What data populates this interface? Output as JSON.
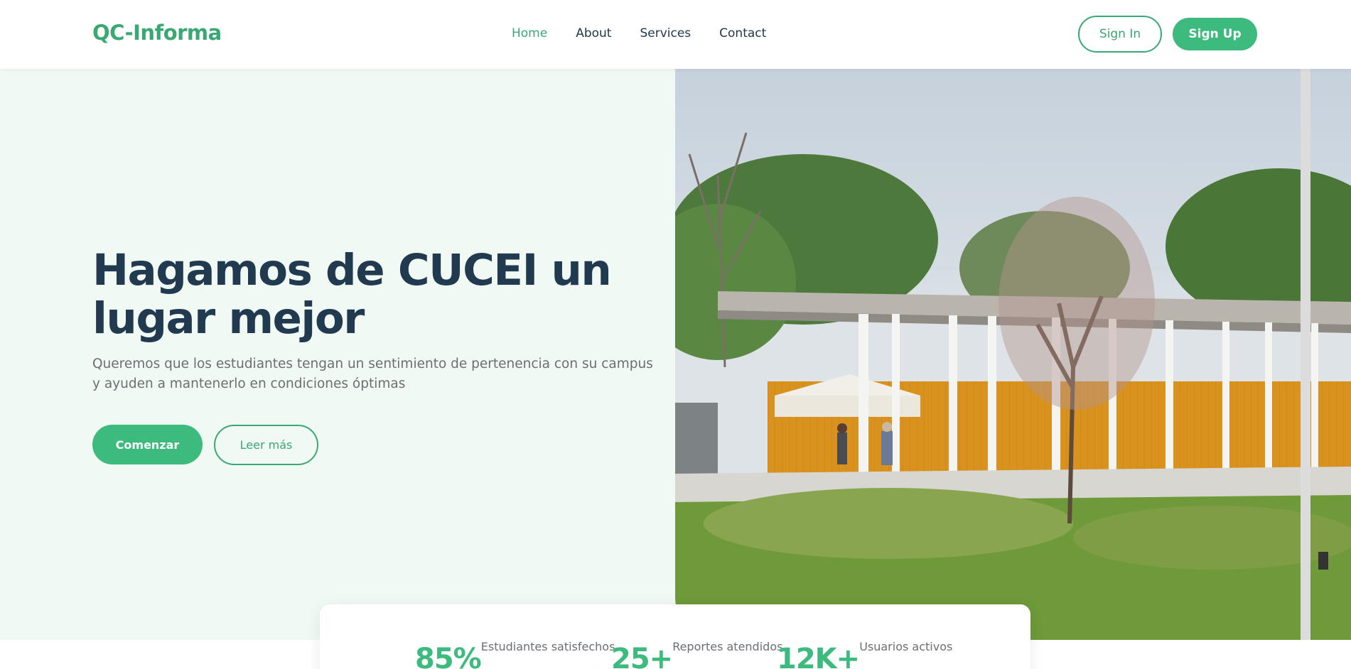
{
  "header": {
    "logo": "QC-Informa",
    "nav": [
      {
        "label": "Home",
        "active": true
      },
      {
        "label": "About",
        "active": false
      },
      {
        "label": "Services",
        "active": false
      },
      {
        "label": "Contact",
        "active": false
      }
    ],
    "sign_in": "Sign In",
    "sign_up": "Sign Up"
  },
  "hero": {
    "title": "Hagamos de CUCEI un lugar mejor",
    "description": "Queremos que los estudiantes tengan un sentimiento de pertenencia con su campus y ayuden a mantenerlo en condiciones óptimas",
    "primary_button": "Comenzar",
    "secondary_button": "Leer más",
    "image_icon": "campus-photo"
  },
  "stats": [
    {
      "value": "85%",
      "label": "Estudiantes satisfechos"
    },
    {
      "value": "25+",
      "label": "Reportes atendidos"
    },
    {
      "value": "12K+",
      "label": "Usuarios activos"
    }
  ],
  "colors": {
    "accent": "#3dba7d",
    "accent_dark": "#3aa872",
    "heading": "#213a4f",
    "body_text": "#6b6f73",
    "hero_bg": "#f0f9f3"
  }
}
